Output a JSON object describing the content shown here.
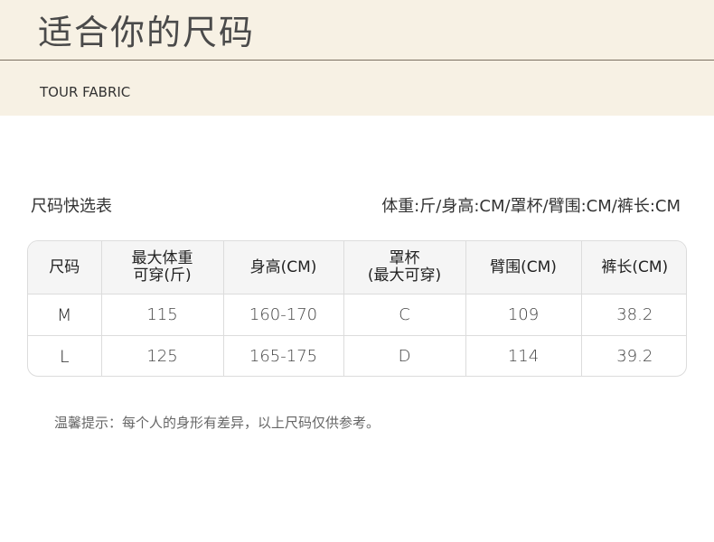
{
  "header": {
    "title": "适合你的尺码",
    "subtitle": "TOUR FABRIC"
  },
  "section": {
    "label": "尺码快选表",
    "units": "体重:斤/身高:CM/罩杯/臂围:CM/裤长:CM"
  },
  "table": {
    "headers": [
      [
        "尺码"
      ],
      [
        "最大体重",
        "可穿(斤)"
      ],
      [
        "身高(CM)"
      ],
      [
        "罩杯",
        "(最大可穿)"
      ],
      [
        "臂围(CM)"
      ],
      [
        "裤长(CM)"
      ]
    ],
    "rows": [
      [
        "M",
        "115",
        "160-170",
        "C",
        "109",
        "38.2"
      ],
      [
        "L",
        "125",
        "165-175",
        "D",
        "114",
        "39.2"
      ]
    ]
  },
  "note": "温馨提示：每个人的身形有差异，以上尺码仅供参考。",
  "colors": {
    "header_bg": "#f7f1e4",
    "table_header_bg": "#f5f5f5",
    "border": "#dcdcdc"
  }
}
